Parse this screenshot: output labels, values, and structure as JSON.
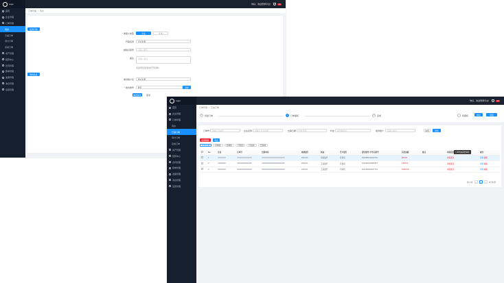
{
  "app": {
    "logo_text": "Logo",
    "role": "用户端",
    "greeting": "你好，欢迎登录平台！",
    "notifications": "10"
  },
  "nav": {
    "items": [
      "首页",
      "企业管理",
      "订单管理",
      "待办",
      "已提订单",
      "待付订单",
      "完成订单",
      "资产管理",
      "结算中心",
      "合同管理",
      "账单管理",
      "发票管理",
      "消息管理",
      "设置管理"
    ]
  },
  "form": {
    "breadcrumb": [
      "订单管理",
      "待办"
    ],
    "section1": "出票订单",
    "section2": "附件信息",
    "pay_type_label": "* 收票人类型",
    "pay_type_on": "企业",
    "pay_type_off": "个人",
    "company_label": "开票名称",
    "company_value": "企业名称",
    "taxno_label": "纳税识别号",
    "taxno_placeholder": "请输入税号",
    "remark_label": "备注",
    "remark_placeholder": "请输入备注",
    "hint": "请选择您需要提交的开票资料",
    "bank_label": "收款账户名",
    "bank_value": "账户名称",
    "account_label": "* 收款账号",
    "account_value": "账号",
    "account_button": "选择",
    "submit": "确定提交",
    "cancel": "取消"
  },
  "list": {
    "breadcrumb": [
      "订单管理",
      "已提订单"
    ],
    "steps": [
      {
        "num": "1",
        "label": "创建订单"
      },
      {
        "num": "2",
        "label": "订单审核"
      },
      {
        "num": "3",
        "label": "完成"
      }
    ],
    "step_right_label": "待审核",
    "step_right_buttons": [
      "通过",
      "驳回"
    ],
    "filters": [
      {
        "label": "订单号",
        "placeholder": "请输入订单号"
      },
      {
        "label": "企业名称",
        "placeholder": "请输入企业名称"
      },
      {
        "label": "出票日期",
        "placeholder": "开始日期"
      },
      {
        "label": "状态",
        "placeholder": "请选择状态"
      },
      {
        "label": "收款账户",
        "placeholder": "请输入账户"
      }
    ],
    "reset": "重置",
    "search": "搜索",
    "action_buttons": [
      "批量审核",
      "导出"
    ],
    "tabs": [
      "全部订单",
      "待审核",
      "已审核",
      "已驳回",
      "已退票",
      "已完成"
    ],
    "columns": [
      "No",
      "企业",
      "订单号",
      "出票时间",
      "收款银行",
      "状态",
      "开户银行",
      "银行账号/卡号/识别号",
      "实发金额",
      "备注",
      "审核意见",
      "操作"
    ],
    "rows": [
      {
        "no": "1",
        "date": "2023-01",
        "bank": "招商银行",
        "status": "待审核",
        "acct": "6212580011022781",
        "amount": "800.00",
        "remark": "审核通过",
        "ops": [
          "详情",
          "编辑"
        ]
      },
      {
        "no": "2",
        "date": "2023-01",
        "bank": "工商银行",
        "status": "待审核",
        "acct": "6212260200045507",
        "amount": "1450.00",
        "remark": "审核通过",
        "ops": [
          "详情",
          "编辑"
        ]
      },
      {
        "no": "3",
        "date": "2023-01",
        "bank": "工商银行",
        "status": "待审核",
        "acct": "6212260200017761",
        "amount": "35000.00",
        "remark": "审核通过",
        "ops": [
          "详情",
          "编辑"
        ]
      }
    ],
    "tooltip": "订单状态需要审核",
    "pager_total": "共 3 条",
    "pager_page": "1",
    "pager_size": "10 条/页"
  },
  "colors": {
    "accent": "#1890ff",
    "danger": "#f5222d",
    "sidebar": "#161f2e"
  }
}
